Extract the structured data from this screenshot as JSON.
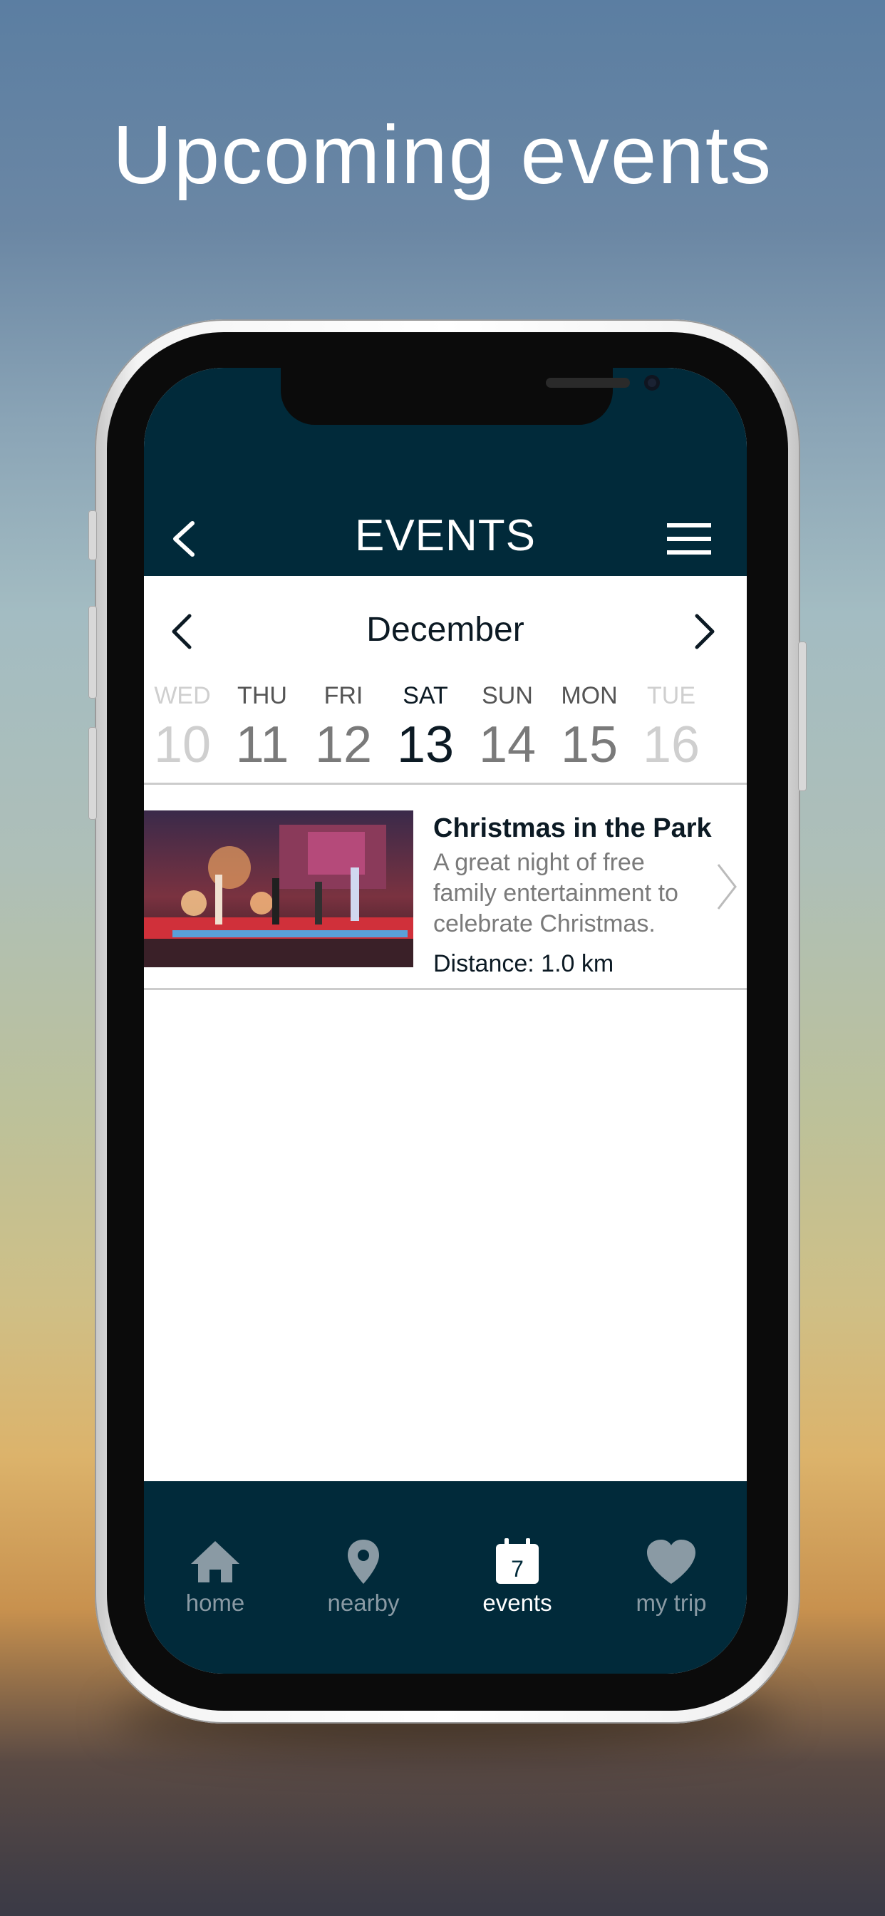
{
  "promo": {
    "title": "Upcoming events"
  },
  "header": {
    "title": "EVENTS"
  },
  "calendar": {
    "month": "December",
    "days": [
      {
        "name": "WED",
        "num": "10"
      },
      {
        "name": "THU",
        "num": "11"
      },
      {
        "name": "FRI",
        "num": "12"
      },
      {
        "name": "SAT",
        "num": "13"
      },
      {
        "name": "SUN",
        "num": "14"
      },
      {
        "name": "MON",
        "num": "15"
      },
      {
        "name": "TUE",
        "num": "16"
      }
    ]
  },
  "events": [
    {
      "title": "Christmas in the Park",
      "description": "A great night of free family entertainment to celebrate Christmas.",
      "distance": "Distance: 1.0 km"
    }
  ],
  "tabbar": {
    "items": [
      {
        "label": "home",
        "icon": "home-icon"
      },
      {
        "label": "nearby",
        "icon": "map-pin-icon"
      },
      {
        "label": "events",
        "icon": "calendar-icon",
        "badge": "7"
      },
      {
        "label": "my trip",
        "icon": "heart-icon"
      }
    ]
  },
  "colors": {
    "brand": "#012a3a",
    "accent_text": "#0c1a24",
    "muted": "#7a7a7a"
  }
}
